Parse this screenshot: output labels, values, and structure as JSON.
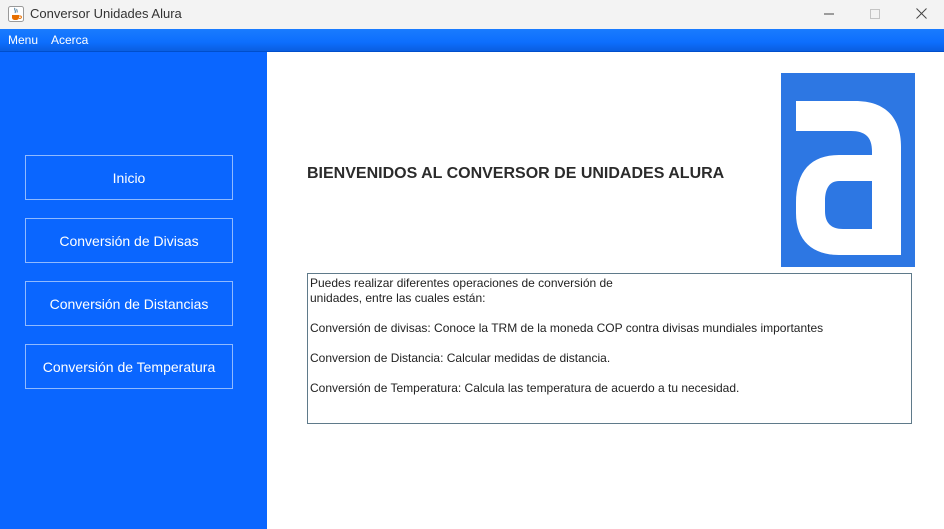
{
  "window": {
    "title": "Conversor Unidades Alura"
  },
  "menubar": {
    "items": [
      {
        "label": "Menu"
      },
      {
        "label": "Acerca"
      }
    ]
  },
  "sidebar": {
    "buttons": [
      {
        "label": "Inicio"
      },
      {
        "label": "Conversión de Divisas"
      },
      {
        "label": "Conversión de Distancias"
      },
      {
        "label": "Conversión de Temperatura"
      }
    ]
  },
  "main": {
    "welcome": "BIENVENIDOS AL CONVERSOR DE UNIDADES ALURA",
    "info_lines": [
      "Puedes realizar diferentes operaciones de conversión de",
      "unidades, entre las cuales están:",
      "Conversión de divisas: Conoce la TRM de la moneda COP contra divisas mundiales importantes",
      "Conversion de Distancia: Calcular medidas de distancia.",
      "Conversión de Temperatura: Calcula las temperatura de acuerdo a tu necesidad."
    ]
  },
  "colors": {
    "sidebar": "#0a66ff",
    "menubar": "#0d6efd",
    "logo_bg": "#2d77e3"
  },
  "icons": {
    "app": "java-cup-icon",
    "minimize": "minimize-icon",
    "maximize": "maximize-icon",
    "close": "close-icon",
    "logo": "alura-logo"
  }
}
